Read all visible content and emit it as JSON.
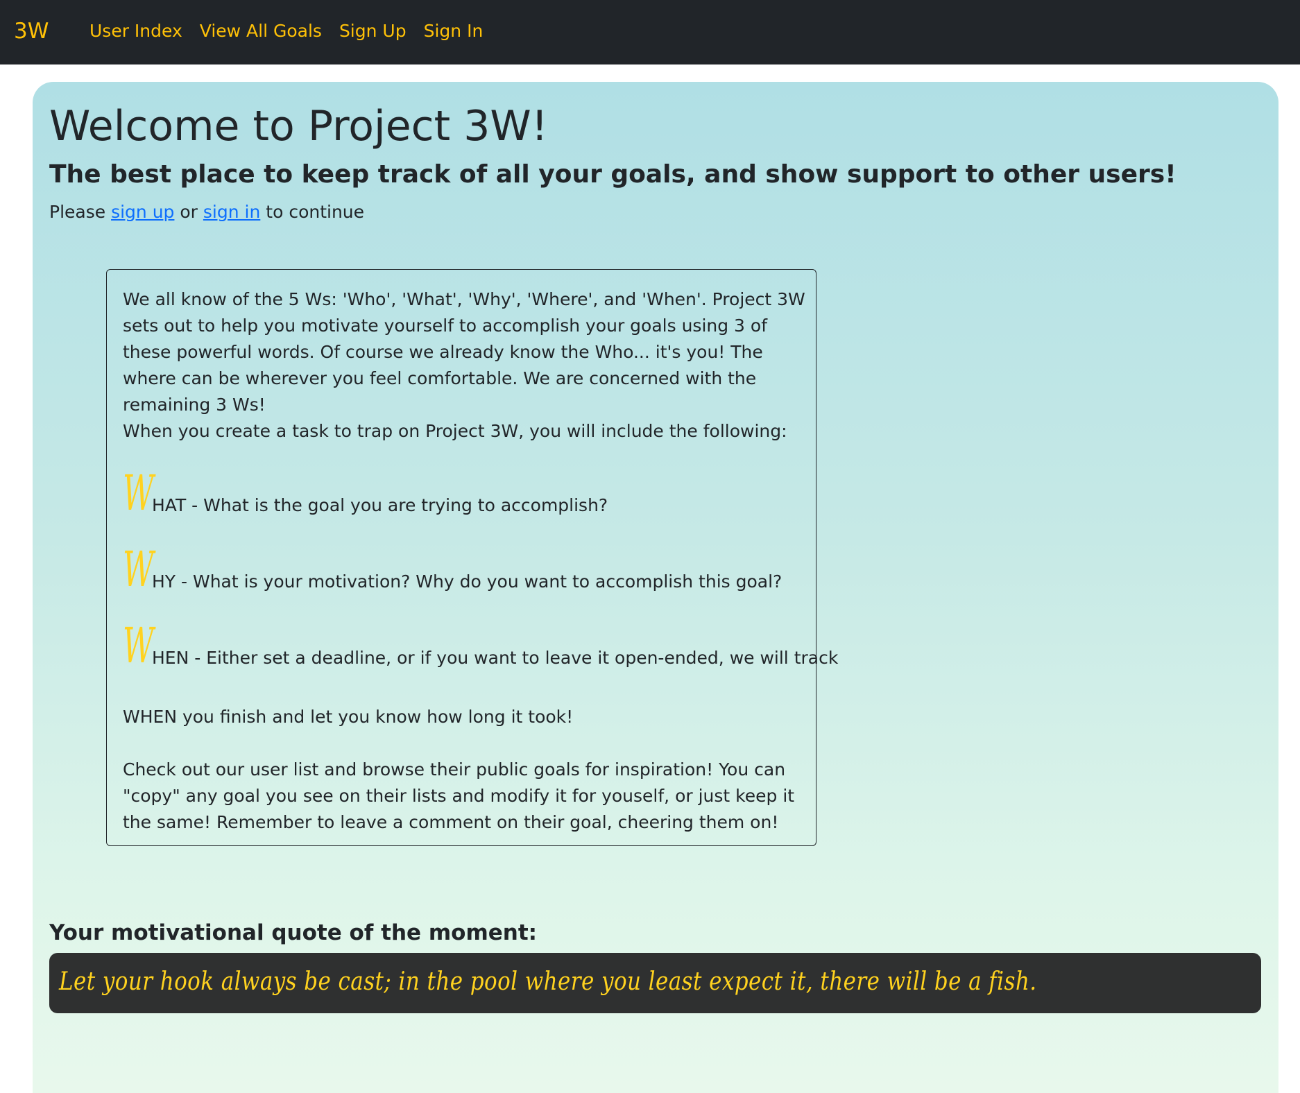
{
  "nav": {
    "brand": "3W",
    "links": [
      "User Index",
      "View All Goals",
      "Sign Up",
      "Sign In"
    ]
  },
  "hero": {
    "title": "Welcome to Project 3W!",
    "subtitle": "The best place to keep track of all your goals, and show support to other users!",
    "prompt": {
      "before": "Please ",
      "sign_up": "sign up",
      "middle": " or ",
      "sign_in": "sign in",
      "after": " to continue"
    }
  },
  "info": {
    "intro": "We all know of the 5 Ws: 'Who', 'What', 'Why', 'Where', and 'When'. Project 3W sets out to help you motivate yourself to accomplish your goals using 3 of these powerful words. Of course we already know the Who... it's you! The where can be wherever you feel comfortable. We are concerned with the remaining 3 Ws!",
    "create_intro": "When you create a task to trap on Project 3W, you will include the following:",
    "w_letter": "W",
    "what": "HAT - What is the goal you are trying to accomplish?",
    "why": "HY - What is your motivation? Why do you want to accomplish this goal?",
    "when": "HEN - Either set a deadline, or if you want to leave it open-ended, we will track",
    "when_continued": "WHEN you finish and let you know how long it took!",
    "outro": "Check out our user list and browse their public goals for inspiration! You can \"copy\" any goal you see on their lists and modify it for youself, or just keep it the same! Remember to leave a comment on their goal, cheering them on!"
  },
  "quote": {
    "heading": "Your motivational quote of the moment:",
    "text": "Let your hook always be cast; in the pool where you least expect it, there will be a fish."
  },
  "colors": {
    "navbar_bg": "#212529",
    "accent": "#ffc107",
    "link": "#0d6efd",
    "quote_bg": "#2f3030"
  }
}
